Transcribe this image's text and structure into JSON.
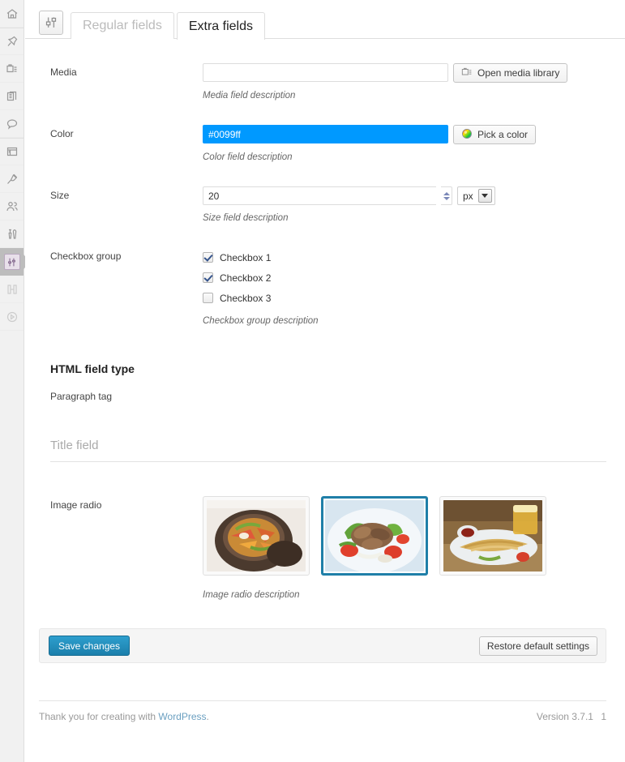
{
  "sidebar": {
    "items": [
      {
        "name": "dashboard",
        "icon": "home-icon",
        "active": false
      },
      {
        "name": "posts",
        "icon": "pin-icon",
        "active": false
      },
      {
        "name": "media",
        "icon": "media-icon",
        "active": false
      },
      {
        "name": "pages",
        "icon": "pages-icon",
        "active": false
      },
      {
        "name": "comments",
        "icon": "comment-bubble-icon",
        "active": false
      },
      {
        "name": "appearance",
        "icon": "appearance-icon",
        "active": false
      },
      {
        "name": "plugins",
        "icon": "plug-icon",
        "active": false
      },
      {
        "name": "users",
        "icon": "users-icon",
        "active": false
      },
      {
        "name": "tools",
        "icon": "tools-icon",
        "active": false
      },
      {
        "name": "settings",
        "icon": "sliders-icon",
        "active": true
      },
      {
        "name": "collapse",
        "icon": "collapse-icon",
        "active": false
      },
      {
        "name": "play",
        "icon": "play-circle-icon",
        "active": false
      }
    ]
  },
  "tabs": {
    "icon": "sliders-icon",
    "items": [
      {
        "label": "Regular fields",
        "active": false
      },
      {
        "label": "Extra fields",
        "active": true
      }
    ]
  },
  "fields": {
    "media": {
      "label": "Media",
      "value": "",
      "placeholder": "",
      "button_label": "Open media library",
      "button_icon": "media-library-icon",
      "description": "Media field description"
    },
    "color": {
      "label": "Color",
      "value": "#0099ff",
      "swatch": "#0099ff",
      "button_label": "Pick a color",
      "button_icon": "color-wheel-icon",
      "description": "Color field description"
    },
    "size": {
      "label": "Size",
      "value": "20",
      "unit": "px",
      "description": "Size field description"
    },
    "checkbox_group": {
      "label": "Checkbox group",
      "options": [
        {
          "label": "Checkbox 1",
          "checked": true
        },
        {
          "label": "Checkbox 2",
          "checked": true
        },
        {
          "label": "Checkbox 3",
          "checked": false
        }
      ],
      "description": "Checkbox group description"
    },
    "html": {
      "heading": "HTML field type",
      "paragraph": "Paragraph tag"
    },
    "title_field": {
      "label": "Title field"
    },
    "image_radio": {
      "label": "Image radio",
      "options": [
        {
          "alt": "stir fry in clay pot",
          "selected": false
        },
        {
          "alt": "beef salad plate",
          "selected": true
        },
        {
          "alt": "breaded fish with beer",
          "selected": false
        }
      ],
      "description": "Image radio description"
    }
  },
  "submit": {
    "save_label": "Save changes",
    "restore_label": "Restore default settings"
  },
  "footer": {
    "thanks_prefix": "Thank you for creating with ",
    "link_label": "WordPress",
    "thanks_suffix": ".",
    "version": "Version 3.7.1",
    "trailing": "1"
  },
  "colors": {
    "accent": "#0099ff",
    "primary_button": "#2180a8",
    "selected_border": "#1f7fa8",
    "link": "#6a9fc0"
  }
}
